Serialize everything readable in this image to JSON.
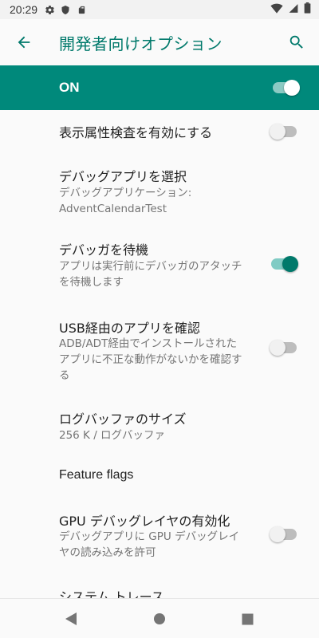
{
  "status_bar": {
    "time": "20:29",
    "left_icons": [
      "gear-icon",
      "shield-icon",
      "sd-card-icon"
    ],
    "right_icons": [
      "wifi-icon",
      "signal-icon",
      "battery-icon"
    ]
  },
  "toolbar": {
    "back_icon": "arrow-back-icon",
    "title": "開発者向けオプション",
    "search_icon": "search-icon"
  },
  "master_switch": {
    "label": "ON",
    "checked": true
  },
  "settings": {
    "items": [
      {
        "title": "表示属性検査を有効にする",
        "summary": [],
        "switch": "off"
      },
      {
        "title": "デバッグアプリを選択",
        "summary": [
          "デバッグアプリケーション:",
          "AdventCalendarTest"
        ],
        "switch": null
      },
      {
        "title": "デバッガを待機",
        "summary": [
          "アプリは実行前にデバッガのアタッチ",
          "を待機します"
        ],
        "switch": "on"
      },
      {
        "title": "USB経由のアプリを確認",
        "summary": [
          "ADB/ADT経由でインストールされた",
          "アプリに不正な動作がないかを確認す",
          "る"
        ],
        "switch": "off"
      },
      {
        "title": "ログバッファのサイズ",
        "summary": [
          "256 K / ログバッファ"
        ],
        "switch": null
      },
      {
        "title": "Feature flags",
        "summary": [],
        "switch": null
      },
      {
        "title": "GPU デバッグレイヤの有効化",
        "summary": [
          "デバッグアプリに GPU デバッグレイ",
          "ヤの読み込みを許可"
        ],
        "switch": "off"
      },
      {
        "title": "システム トレース",
        "summary": [],
        "switch": null
      }
    ]
  },
  "colors": {
    "accent": "#00796b",
    "master_bar": "#00897b",
    "background": "#fafafa"
  },
  "nav_bar": {
    "icons": [
      "back-triangle-icon",
      "home-circle-icon",
      "recents-square-icon"
    ]
  }
}
